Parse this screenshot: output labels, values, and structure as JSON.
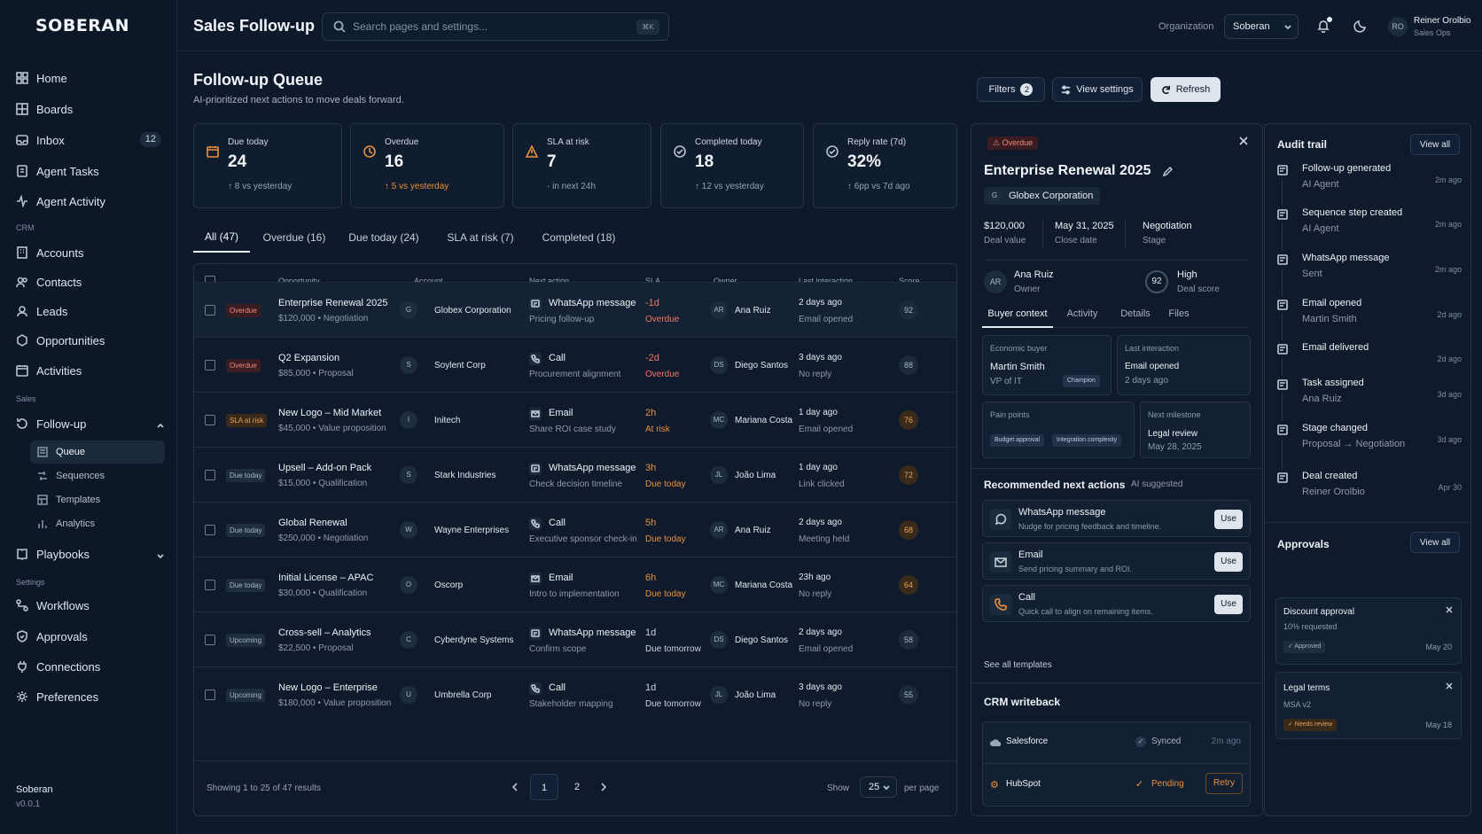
{
  "app": {
    "brand": "SOBERAN",
    "page_title": "Sales Follow-up",
    "version_name": "Soberan",
    "version": "v0.0.1"
  },
  "search": {
    "placeholder": "Search pages and settings...",
    "shortcut": "⌘K"
  },
  "header": {
    "org_label": "Organization",
    "org_value": "Soberan",
    "user_initials": "RO",
    "user_name": "Reiner Orolbio",
    "user_role": "Sales Ops"
  },
  "sidebar": {
    "items": [
      {
        "label": "Home",
        "icon": "home-icon"
      },
      {
        "label": "Boards",
        "icon": "grid-icon"
      },
      {
        "label": "Inbox",
        "icon": "inbox-icon",
        "badge": "12"
      },
      {
        "label": "Agent Tasks",
        "icon": "tasks-icon"
      },
      {
        "label": "Agent Activity",
        "icon": "activity-icon"
      }
    ],
    "crm_label": "CRM",
    "crm_items": [
      {
        "label": "Accounts",
        "icon": "accounts-icon"
      },
      {
        "label": "Contacts",
        "icon": "contacts-icon"
      },
      {
        "label": "Leads",
        "icon": "leads-icon"
      },
      {
        "label": "Opportunities",
        "icon": "opportunities-icon"
      },
      {
        "label": "Activities",
        "icon": "activities-icon"
      }
    ],
    "sales_label": "Sales",
    "followup_label": "Follow-up",
    "followup_sub": [
      {
        "label": "Queue"
      },
      {
        "label": "Sequences"
      },
      {
        "label": "Templates"
      },
      {
        "label": "Analytics"
      }
    ],
    "playbooks_label": "Playbooks",
    "settings_label": "Settings",
    "settings_items": [
      {
        "label": "Workflows"
      },
      {
        "label": "Approvals"
      },
      {
        "label": "Connections"
      },
      {
        "label": "Preferences"
      }
    ]
  },
  "queue": {
    "title": "Follow-up Queue",
    "subtitle": "AI-prioritized next actions to move deals forward.",
    "filters_label": "Filters",
    "filters_count": "2",
    "view_settings_label": "View settings",
    "refresh_label": "Refresh"
  },
  "stats": [
    {
      "label": "Due today",
      "value": "24",
      "sub": "↑ 8 vs yesterday"
    },
    {
      "label": "Overdue",
      "value": "16",
      "sub": "↑ 5 vs yesterday"
    },
    {
      "label": "SLA at risk",
      "value": "7",
      "sub": "· in next 24h"
    },
    {
      "label": "Completed today",
      "value": "18",
      "sub": "↑ 12 vs yesterday"
    },
    {
      "label": "Reply rate (7d)",
      "value": "32%",
      "sub": "↑ 6pp vs 7d ago"
    }
  ],
  "tabs": [
    "All (47)",
    "Overdue (16)",
    "Due today (24)",
    "SLA at risk (7)",
    "Completed (18)"
  ],
  "table": {
    "headers": [
      "Opportunity",
      "Account",
      "Next action",
      "SLA",
      "Owner",
      "Last interaction",
      "Score"
    ],
    "rows": [
      {
        "status": "Overdue",
        "name": "Enterprise Renewal 2025",
        "meta": "$120,000 • Negotiation",
        "acct_i": "G",
        "account": "Globex Corporation",
        "action": "WhatsApp message",
        "action_sub": "Pricing follow-up",
        "sla": "-1d",
        "sla_sub": "Overdue",
        "owner_i": "AR",
        "owner": "Ana Ruiz",
        "last": "2 days ago",
        "last_sub": "Email opened",
        "score": "92"
      },
      {
        "status": "Overdue",
        "name": "Q2 Expansion",
        "meta": "$85,000 • Proposal",
        "acct_i": "S",
        "account": "Soylent Corp",
        "action": "Call",
        "action_sub": "Procurement alignment",
        "sla": "-2d",
        "sla_sub": "Overdue",
        "owner_i": "DS",
        "owner": "Diego Santos",
        "last": "3 days ago",
        "last_sub": "No reply",
        "score": "88"
      },
      {
        "status": "SLA at risk",
        "name": "New Logo – Mid Market",
        "meta": "$45,000 • Value proposition",
        "acct_i": "I",
        "account": "Initech",
        "action": "Email",
        "action_sub": "Share ROI case study",
        "sla": "2h",
        "sla_sub": "At risk",
        "owner_i": "MC",
        "owner": "Mariana Costa",
        "last": "1 day ago",
        "last_sub": "Email opened",
        "score": "76"
      },
      {
        "status": "Due today",
        "name": "Upsell – Add-on Pack",
        "meta": "$15,000 • Qualification",
        "acct_i": "S",
        "account": "Stark Industries",
        "action": "WhatsApp message",
        "action_sub": "Check decision timeline",
        "sla": "3h",
        "sla_sub": "Due today",
        "owner_i": "JL",
        "owner": "João Lima",
        "last": "1 day ago",
        "last_sub": "Link clicked",
        "score": "72"
      },
      {
        "status": "Due today",
        "name": "Global Renewal",
        "meta": "$250,000 • Negotiation",
        "acct_i": "W",
        "account": "Wayne Enterprises",
        "action": "Call",
        "action_sub": "Executive sponsor check-in",
        "sla": "5h",
        "sla_sub": "Due today",
        "owner_i": "AR",
        "owner": "Ana Ruiz",
        "last": "2 days ago",
        "last_sub": "Meeting held",
        "score": "68"
      },
      {
        "status": "Due today",
        "name": "Initial License – APAC",
        "meta": "$30,000 • Qualification",
        "acct_i": "O",
        "account": "Oscorp",
        "action": "Email",
        "action_sub": "Intro to implementation",
        "sla": "6h",
        "sla_sub": "Due today",
        "owner_i": "MC",
        "owner": "Mariana Costa",
        "last": "23h ago",
        "last_sub": "No reply",
        "score": "64"
      },
      {
        "status": "Upcoming",
        "name": "Cross-sell – Analytics",
        "meta": "$22,500 • Proposal",
        "acct_i": "C",
        "account": "Cyberdyne Systems",
        "action": "WhatsApp message",
        "action_sub": "Confirm scope",
        "sla": "1d",
        "sla_sub": "Due tomorrow",
        "owner_i": "DS",
        "owner": "Diego Santos",
        "last": "2 days ago",
        "last_sub": "Email opened",
        "score": "58"
      },
      {
        "status": "Upcoming",
        "name": "New Logo – Enterprise",
        "meta": "$180,000 • Value proposition",
        "acct_i": "U",
        "account": "Umbrella Corp",
        "action": "Call",
        "action_sub": "Stakeholder mapping",
        "sla": "1d",
        "sla_sub": "Due tomorrow",
        "owner_i": "JL",
        "owner": "João Lima",
        "last": "3 days ago",
        "last_sub": "No reply",
        "score": "55"
      }
    ],
    "showing": "Showing 1 to 25 of 47 results",
    "pages": [
      "1",
      "2"
    ],
    "show_label": "Show",
    "per_page": "25",
    "per_page_label": "per page"
  },
  "detail": {
    "badge": "Overdue",
    "title": "Enterprise Renewal 2025",
    "account_i": "G",
    "account": "Globex Corporation",
    "value": "$120,000",
    "value_label": "Deal value",
    "close": "May 31, 2025",
    "close_label": "Close date",
    "stage": "Negotiation",
    "stage_label": "Stage",
    "owner_i": "AR",
    "owner": "Ana Ruiz",
    "owner_label": "Owner",
    "score": "92",
    "score_level": "High",
    "score_label": "Deal score",
    "tabs": [
      "Buyer context",
      "Activity",
      "Details",
      "Files"
    ],
    "econ_label": "Economic buyer",
    "econ_name": "Martin Smith",
    "econ_role": "VP of IT",
    "econ_tag": "Champion",
    "last_label": "Last interaction",
    "last_value": "Email opened",
    "last_time": "2 days ago",
    "pain_label": "Pain points",
    "pain_tags": [
      "Budget approval",
      "Integration complexity"
    ],
    "milestone_label": "Next milestone",
    "milestone_value": "Legal review",
    "milestone_date": "May 28, 2025",
    "rec_title": "Recommended next actions",
    "rec_ai": "AI suggested",
    "recs": [
      {
        "title": "WhatsApp message",
        "sub": "Nudge for pricing feedback and timeline.",
        "btn": "Use"
      },
      {
        "title": "Email",
        "sub": "Send pricing summary and ROI.",
        "btn": "Use"
      },
      {
        "title": "Call",
        "sub": "Quick call to align on remaining items.",
        "btn": "Use"
      }
    ],
    "see_all": "See all templates",
    "crm_title": "CRM writeback",
    "sf_name": "Salesforce",
    "sf_status": "Synced",
    "sf_time": "2m ago",
    "hs_name": "HubSpot",
    "hs_status": "Pending",
    "hs_btn": "Retry"
  },
  "audit": {
    "title": "Audit trail",
    "view_all": "View all",
    "events": [
      {
        "title": "Follow-up generated",
        "sub": "AI Agent",
        "time": "2m ago"
      },
      {
        "title": "Sequence step created",
        "sub": "AI Agent",
        "time": "2m ago"
      },
      {
        "title": "WhatsApp message",
        "sub": "Sent",
        "time": "2m ago"
      },
      {
        "title": "Email opened",
        "sub": "Martin Smith",
        "time": "2d ago"
      },
      {
        "title": "Email delivered",
        "sub": "",
        "time": "2d ago"
      },
      {
        "title": "Task assigned",
        "sub": "Ana Ruiz",
        "time": "3d ago"
      },
      {
        "title": "Stage changed",
        "sub": "Proposal → Negotiation",
        "time": "3d ago"
      },
      {
        "title": "Deal created",
        "sub": "Reiner Orolbio",
        "time": "Apr 30"
      }
    ],
    "approvals_title": "Approvals",
    "approvals_view_all": "View all",
    "approvals": [
      {
        "title": "Discount approval",
        "sub": "10% requested",
        "status": "✓ Approved",
        "date": "May 20"
      },
      {
        "title": "Legal terms",
        "sub": "MSA v2",
        "status": "✓ Needs review",
        "date": "May 18"
      }
    ]
  },
  "colors": {
    "bg": "#0e1a2b",
    "accent_red": "#f0785f",
    "accent_orange": "#e8913d",
    "success": "#4cc38a"
  }
}
